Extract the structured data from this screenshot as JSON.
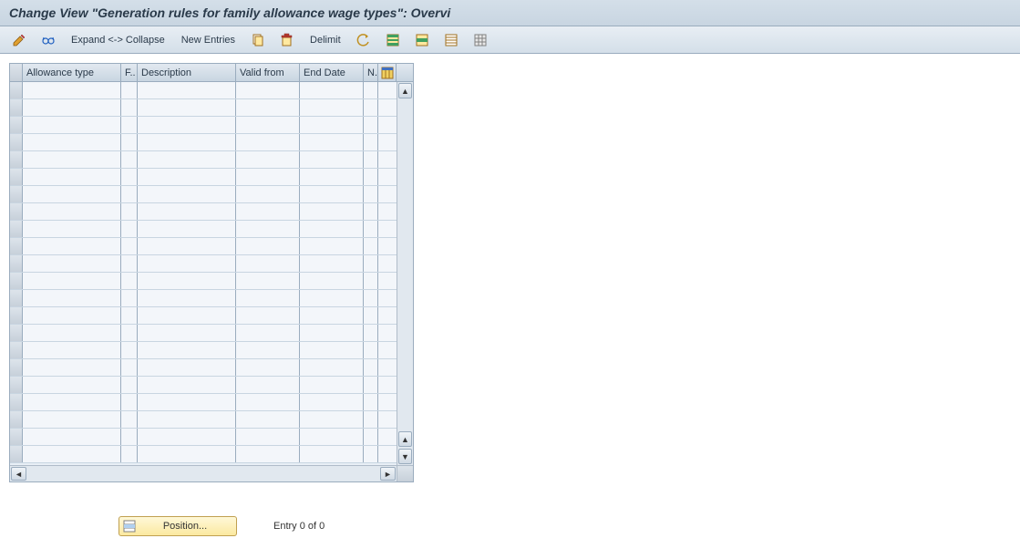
{
  "title": "Change View \"Generation rules for family allowance wage types\": Overvi",
  "toolbar": {
    "expand_collapse": "Expand <-> Collapse",
    "new_entries": "New Entries",
    "delimit": "Delimit"
  },
  "grid": {
    "headers": {
      "allowance_type": "Allowance type",
      "f": "F..",
      "description": "Description",
      "valid_from": "Valid from",
      "end_date": "End Date",
      "n": "N."
    },
    "rows": []
  },
  "footer": {
    "position_label": "Position...",
    "entry_status": "Entry 0 of 0"
  },
  "icons": {
    "pencil": "pencil-icon",
    "glasses": "display-icon",
    "copy": "copy-icon",
    "delete": "delete-icon",
    "undo": "undo-icon",
    "select_all": "select-all-icon",
    "select_block": "select-block-icon",
    "deselect": "deselect-icon",
    "config": "config-icon",
    "position": "position-icon"
  }
}
